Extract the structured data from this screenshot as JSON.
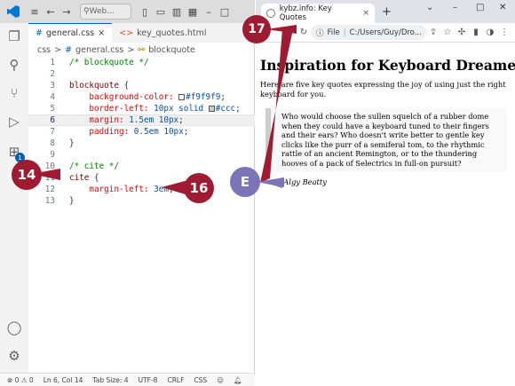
{
  "vscode": {
    "search_placeholder": "Web...",
    "tabs": [
      {
        "label": "general.css",
        "icon": "#"
      },
      {
        "label": "key_quotes.html",
        "icon": "<>"
      }
    ],
    "breadcrumb": [
      "css",
      "general.css",
      "blockquote"
    ],
    "breadcrumb_sep": ">",
    "lines": [
      {
        "n": "10",
        "text": ""
      },
      {
        "n": "11",
        "text": ""
      },
      {
        "n": "12",
        "text": ""
      },
      {
        "n": "13",
        "text": ""
      }
    ],
    "code": {
      "l1": "/* blockquote */",
      "l3_sel": "blockquote",
      "l4_prop": "background-color:",
      "l4_val": "#f9f9f9",
      "l5_prop": "border-left:",
      "l5_val_a": "10px solid",
      "l5_val_b": "#ccc",
      "l6_prop": "margin:",
      "l6_val": "1.5em 10px",
      "l7_prop": "padding:",
      "l7_val": "0.5em 10px",
      "close": "}",
      "open": "{",
      "semi": ";",
      "l10": "/* cite */",
      "l11_sel": "cite",
      "l12_prop": "margin-left:",
      "l12_val": "3em"
    },
    "line_numbers": [
      "1",
      "2",
      "3",
      "4",
      "5",
      "6",
      "7",
      "8",
      "9",
      "10",
      "11",
      "12",
      "13"
    ],
    "badge_count": "1",
    "status": {
      "problems": "⊗ 0 ⚠ 0",
      "position": "Ln 6, Col 14",
      "tab_size": "Tab Size: 4",
      "encoding": "UTF-8",
      "eol": "CRLF",
      "language": "CSS"
    },
    "colors": {
      "accent": "#005fb8",
      "swatch1": "#f9f9f9",
      "swatch2": "#cccccc"
    }
  },
  "browser": {
    "tab_title": "kybz.info: Key Quotes",
    "address_label": "File",
    "address": "C:/Users/Guy/Dro...",
    "heading": "Inspiration for Keyboard Dreamers",
    "intro": "Here are five key quotes expressing the joy of using just the right keyboard for you.",
    "quote": "Who would choose the sullen squelch of a rubber dome when they could have a keyboard tuned to their fingers and their ears? Who doesn't write better to gentle key clicks like the purr of a semiferal tom, to the rhythmic rattle of an ancient Remington, or to the thundering hooves of a pack of Selectrics in full-on pursuit?",
    "cite": "—Algy Beatty"
  },
  "callouts": {
    "c14": "14",
    "c16": "16",
    "c17": "17",
    "cE": "E",
    "colors": {
      "red": "#9e1b32",
      "purple": "#7b74b8"
    }
  }
}
